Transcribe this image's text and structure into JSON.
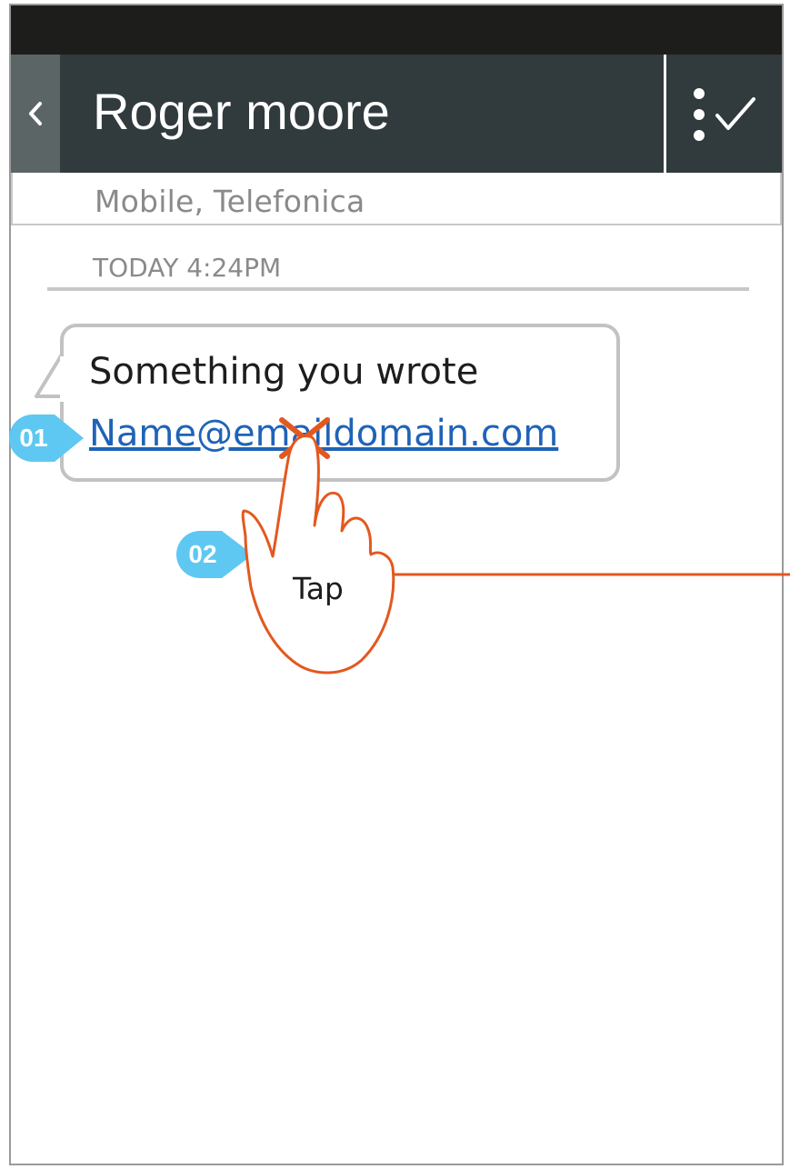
{
  "status_bar": {},
  "header": {
    "back_icon": "chevron-left-icon",
    "title": "Roger moore",
    "action_icon": "more-check-icon"
  },
  "subheader": {
    "text": "Mobile, Telefonica"
  },
  "conversation": {
    "timestamp": "TODAY 4:24PM",
    "message": {
      "text": "Something you wrote",
      "link": "Name@emaildomain.com"
    }
  },
  "annotations": {
    "callout_1": "01",
    "callout_2": "02",
    "gesture_label": "Tap",
    "gesture_icon": "tap-hand-icon",
    "accent_color": "#e3581f",
    "callout_color": "#5ec8f2"
  }
}
